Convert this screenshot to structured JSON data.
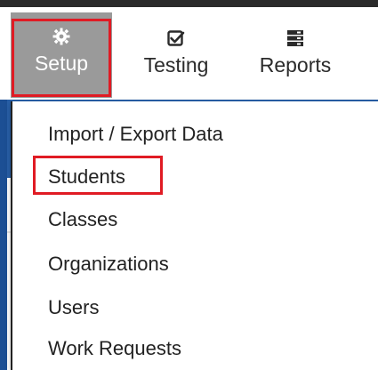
{
  "nav": {
    "items": [
      {
        "label": "Setup",
        "icon": "gear-icon"
      },
      {
        "label": "Testing",
        "icon": "checkbox-icon"
      },
      {
        "label": "Reports",
        "icon": "server-icon"
      }
    ]
  },
  "menu": {
    "items": [
      {
        "label": "Import / Export Data"
      },
      {
        "label": "Students"
      },
      {
        "label": "Classes"
      },
      {
        "label": "Organizations"
      },
      {
        "label": "Users"
      },
      {
        "label": "Work Requests"
      }
    ]
  },
  "colors": {
    "highlight": "#e01b24",
    "active_nav_bg": "#9a9a9a",
    "behind_blue": "#2860a8"
  }
}
